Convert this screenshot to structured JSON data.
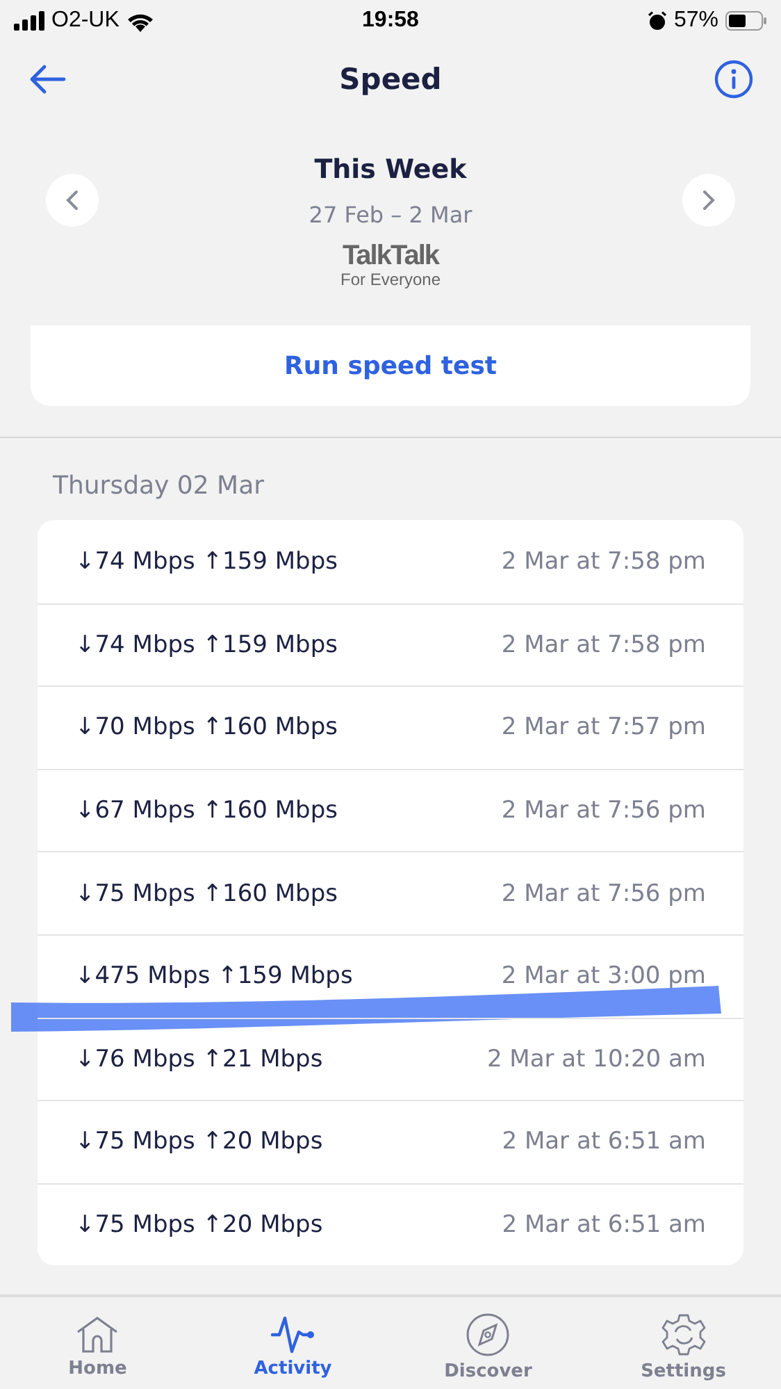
{
  "status_bar": {
    "carrier": "O2-UK",
    "time": "19:58",
    "battery": "57%"
  },
  "header": {
    "title": "Speed"
  },
  "period": {
    "title": "This Week",
    "range": "27 Feb – 2 Mar"
  },
  "brand": {
    "name": "TalkTalk",
    "tagline": "For Everyone"
  },
  "run_button": "Run speed test",
  "section": {
    "heading": "Thursday 02 Mar",
    "results": [
      {
        "speeds": "↓74 Mbps ↑159 Mbps",
        "time": "2 Mar at 7:58 pm",
        "highlighted": false
      },
      {
        "speeds": "↓74 Mbps ↑159 Mbps",
        "time": "2 Mar at 7:58 pm",
        "highlighted": false
      },
      {
        "speeds": "↓70 Mbps ↑160 Mbps",
        "time": "2 Mar at 7:57 pm",
        "highlighted": false
      },
      {
        "speeds": "↓67 Mbps ↑160 Mbps",
        "time": "2 Mar at 7:56 pm",
        "highlighted": false
      },
      {
        "speeds": "↓75 Mbps ↑160 Mbps",
        "time": "2 Mar at 7:56 pm",
        "highlighted": false
      },
      {
        "speeds": "↓475 Mbps ↑159 Mbps",
        "time": "2 Mar at 3:00 pm",
        "highlighted": true
      },
      {
        "speeds": "↓76 Mbps ↑21 Mbps",
        "time": "2 Mar at 10:20 am",
        "highlighted": false
      },
      {
        "speeds": "↓75 Mbps ↑20 Mbps",
        "time": "2 Mar at 6:51 am",
        "highlighted": false
      },
      {
        "speeds": "↓75 Mbps ↑20 Mbps",
        "time": "2 Mar at 6:51 am",
        "highlighted": false
      }
    ]
  },
  "tab_bar": [
    {
      "label": "Home",
      "kind": "home",
      "selected": false
    },
    {
      "label": "Activity",
      "kind": "activity",
      "selected": true
    },
    {
      "label": "Discover",
      "kind": "discover",
      "selected": false
    },
    {
      "label": "Settings",
      "kind": "settings",
      "selected": false
    }
  ]
}
